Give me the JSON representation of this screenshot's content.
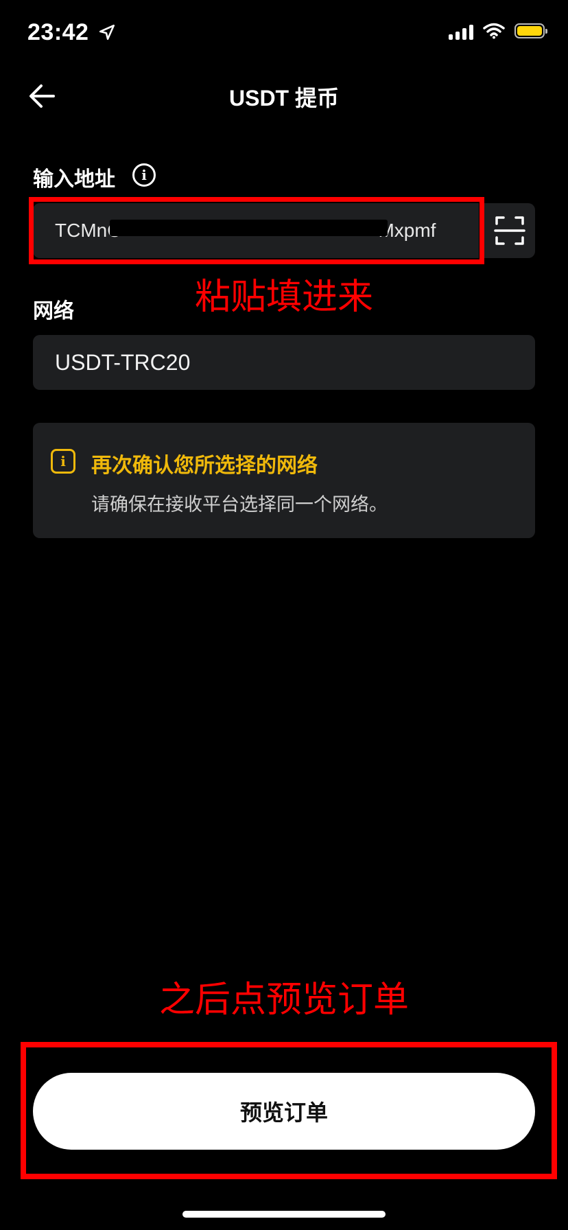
{
  "status_bar": {
    "time": "23:42",
    "icons": [
      "location-arrow-icon",
      "signal-icon",
      "wifi-icon",
      "battery-icon"
    ],
    "battery_color": "#ffd60a"
  },
  "header": {
    "title": "USDT 提币",
    "back_icon": "back-arrow-icon"
  },
  "address": {
    "label": "输入地址",
    "value_start": "TCMnC",
    "value_end": "Mxpmf",
    "scan_icon": "scan-icon"
  },
  "network": {
    "label": "网络",
    "value": "USDT-TRC20"
  },
  "warning": {
    "title": "再次确认您所选择的网络",
    "text": "请确保在接收平台选择同一个网络。",
    "color": "#f0b90b"
  },
  "annotations": {
    "paste": "粘贴填进来",
    "after": "之后点预览订单",
    "color": "#ff0000"
  },
  "actions": {
    "preview_order": "预览订单"
  }
}
